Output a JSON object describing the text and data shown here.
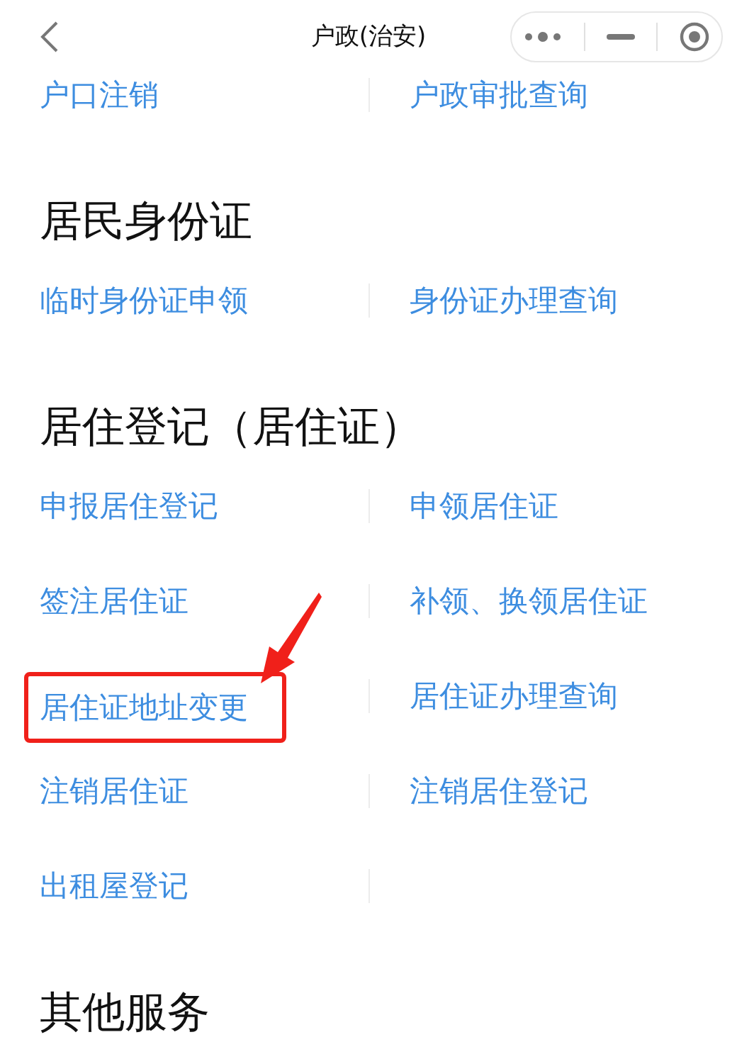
{
  "nav_bar": {
    "title": "户政(治安)"
  },
  "sections": [
    {
      "items": [
        {
          "label": "户口注销",
          "annotated": false
        },
        {
          "label": "户政审批查询",
          "annotated": false
        }
      ]
    },
    {
      "heading": "居民身份证",
      "items": [
        {
          "label": "临时身份证申领",
          "annotated": false
        },
        {
          "label": "身份证办理查询",
          "annotated": false
        }
      ]
    },
    {
      "heading": "居住登记（居住证）",
      "items": [
        {
          "label": "申报居住登记",
          "annotated": false
        },
        {
          "label": "申领居住证",
          "annotated": false
        },
        {
          "label": "签注居住证",
          "annotated": false
        },
        {
          "label": "补领、换领居住证",
          "annotated": false
        },
        {
          "label": "居住证地址变更",
          "annotated": true
        },
        {
          "label": "居住证办理查询",
          "annotated": false
        },
        {
          "label": "注销居住证",
          "annotated": false
        },
        {
          "label": "注销居住登记",
          "annotated": false
        },
        {
          "label": "出租屋登记",
          "annotated": false
        }
      ]
    },
    {
      "heading": "其他服务"
    }
  ]
}
